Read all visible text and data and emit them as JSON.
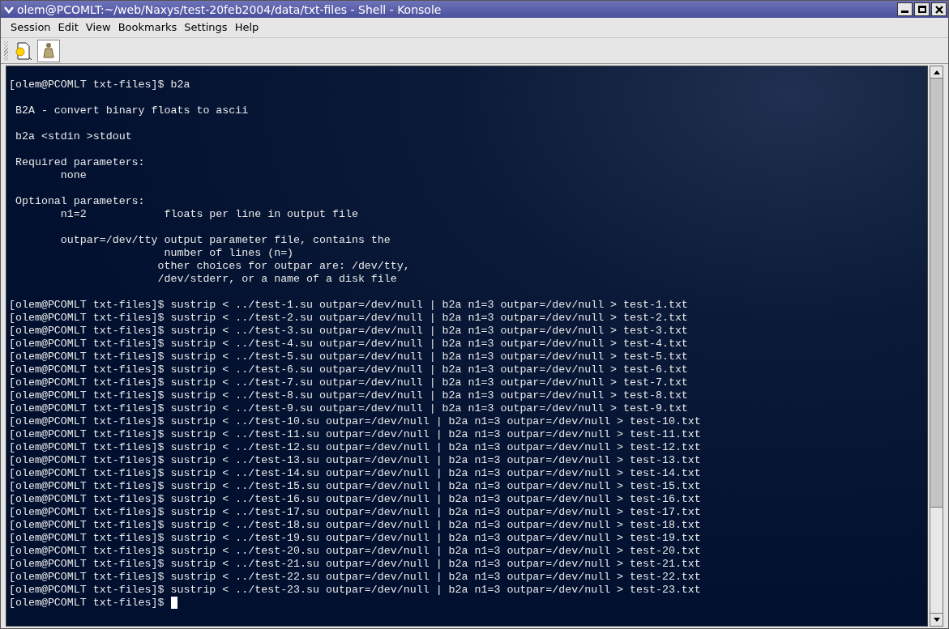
{
  "window": {
    "title": "olem@PCOMLT:~/web/Naxys/test-20feb2004/data/txt-files - Shell - Konsole"
  },
  "menu": [
    "Session",
    "Edit",
    "View",
    "Bookmarks",
    "Settings",
    "Help"
  ],
  "terminal": {
    "blocks": [
      {
        "lines": [
          "[olem@PCOMLT txt-files]$ b2a"
        ]
      },
      {
        "lines": [
          " B2A - convert binary floats to ascii"
        ]
      },
      {
        "lines": [
          " b2a <stdin >stdout"
        ]
      },
      {
        "lines": [
          " Required parameters:",
          "        none"
        ]
      },
      {
        "lines": [
          " Optional parameters:",
          "        n1=2            floats per line in output file"
        ]
      },
      {
        "lines": [
          "        outpar=/dev/tty output parameter file, contains the",
          "                        number of lines (n=)",
          "                       other choices for outpar are: /dev/tty,",
          "                       /dev/stderr, or a name of a disk file"
        ]
      },
      {
        "lines": [
          "[olem@PCOMLT txt-files]$ sustrip < ../test-1.su outpar=/dev/null | b2a n1=3 outpar=/dev/null > test-1.txt",
          "[olem@PCOMLT txt-files]$ sustrip < ../test-2.su outpar=/dev/null | b2a n1=3 outpar=/dev/null > test-2.txt",
          "[olem@PCOMLT txt-files]$ sustrip < ../test-3.su outpar=/dev/null | b2a n1=3 outpar=/dev/null > test-3.txt",
          "[olem@PCOMLT txt-files]$ sustrip < ../test-4.su outpar=/dev/null | b2a n1=3 outpar=/dev/null > test-4.txt",
          "[olem@PCOMLT txt-files]$ sustrip < ../test-5.su outpar=/dev/null | b2a n1=3 outpar=/dev/null > test-5.txt",
          "[olem@PCOMLT txt-files]$ sustrip < ../test-6.su outpar=/dev/null | b2a n1=3 outpar=/dev/null > test-6.txt",
          "[olem@PCOMLT txt-files]$ sustrip < ../test-7.su outpar=/dev/null | b2a n1=3 outpar=/dev/null > test-7.txt",
          "[olem@PCOMLT txt-files]$ sustrip < ../test-8.su outpar=/dev/null | b2a n1=3 outpar=/dev/null > test-8.txt",
          "[olem@PCOMLT txt-files]$ sustrip < ../test-9.su outpar=/dev/null | b2a n1=3 outpar=/dev/null > test-9.txt",
          "[olem@PCOMLT txt-files]$ sustrip < ../test-10.su outpar=/dev/null | b2a n1=3 outpar=/dev/null > test-10.txt",
          "[olem@PCOMLT txt-files]$ sustrip < ../test-11.su outpar=/dev/null | b2a n1=3 outpar=/dev/null > test-11.txt",
          "[olem@PCOMLT txt-files]$ sustrip < ../test-12.su outpar=/dev/null | b2a n1=3 outpar=/dev/null > test-12.txt",
          "[olem@PCOMLT txt-files]$ sustrip < ../test-13.su outpar=/dev/null | b2a n1=3 outpar=/dev/null > test-13.txt",
          "[olem@PCOMLT txt-files]$ sustrip < ../test-14.su outpar=/dev/null | b2a n1=3 outpar=/dev/null > test-14.txt",
          "[olem@PCOMLT txt-files]$ sustrip < ../test-15.su outpar=/dev/null | b2a n1=3 outpar=/dev/null > test-15.txt",
          "[olem@PCOMLT txt-files]$ sustrip < ../test-16.su outpar=/dev/null | b2a n1=3 outpar=/dev/null > test-16.txt",
          "[olem@PCOMLT txt-files]$ sustrip < ../test-17.su outpar=/dev/null | b2a n1=3 outpar=/dev/null > test-17.txt",
          "[olem@PCOMLT txt-files]$ sustrip < ../test-18.su outpar=/dev/null | b2a n1=3 outpar=/dev/null > test-18.txt",
          "[olem@PCOMLT txt-files]$ sustrip < ../test-19.su outpar=/dev/null | b2a n1=3 outpar=/dev/null > test-19.txt",
          "[olem@PCOMLT txt-files]$ sustrip < ../test-20.su outpar=/dev/null | b2a n1=3 outpar=/dev/null > test-20.txt",
          "[olem@PCOMLT txt-files]$ sustrip < ../test-21.su outpar=/dev/null | b2a n1=3 outpar=/dev/null > test-21.txt",
          "[olem@PCOMLT txt-files]$ sustrip < ../test-22.su outpar=/dev/null | b2a n1=3 outpar=/dev/null > test-22.txt",
          "[olem@PCOMLT txt-files]$ sustrip < ../test-23.su outpar=/dev/null | b2a n1=3 outpar=/dev/null > test-23.txt",
          "[olem@PCOMLT txt-files]$"
        ]
      }
    ]
  }
}
